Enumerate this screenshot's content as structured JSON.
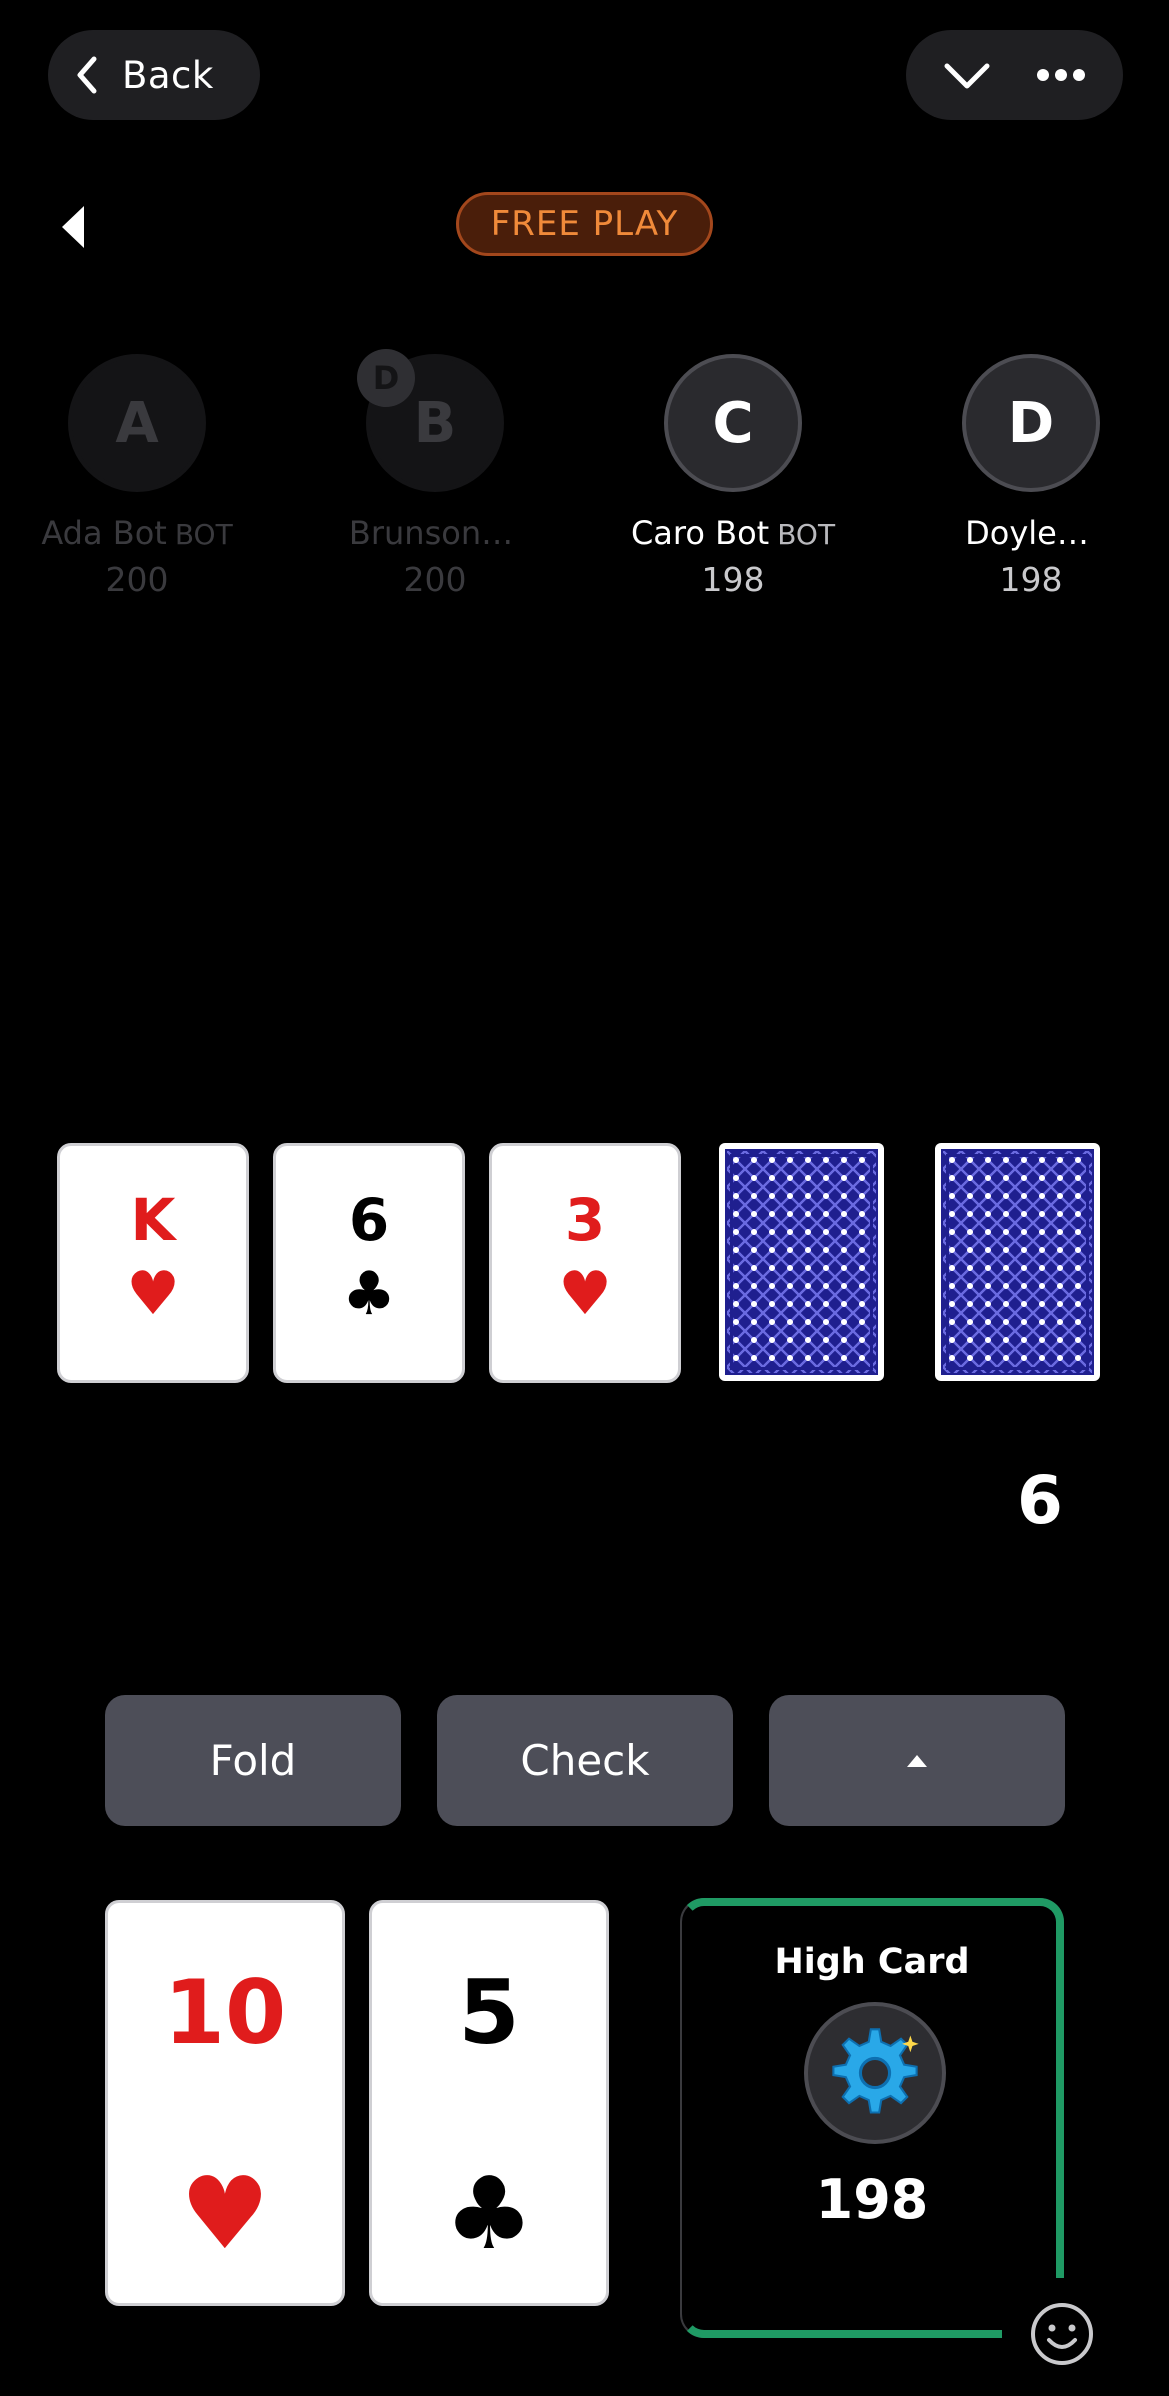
{
  "nav": {
    "back_label": "Back"
  },
  "badge": {
    "label": "FREE PLAY"
  },
  "players": [
    {
      "initial": "A",
      "name": "Ada Bot",
      "bot_tag": "BOT",
      "stack": "200",
      "faded": true,
      "dealer": false
    },
    {
      "initial": "B",
      "name": "Brunson…",
      "bot_tag": "",
      "stack": "200",
      "faded": true,
      "dealer": true
    },
    {
      "initial": "C",
      "name": "Caro Bot",
      "bot_tag": "BOT",
      "stack": "198",
      "faded": false,
      "dealer": false
    },
    {
      "initial": "D",
      "name": "Doyle…",
      "bot_tag": "",
      "stack": "198",
      "faded": false,
      "dealer": false
    }
  ],
  "dealer_label": "D",
  "board": [
    {
      "rank": "K",
      "suit": "♥",
      "color": "red",
      "face_up": true
    },
    {
      "rank": "6",
      "suit": "♣",
      "color": "black",
      "face_up": true
    },
    {
      "rank": "3",
      "suit": "♥",
      "color": "red",
      "face_up": true
    },
    {
      "face_up": false
    },
    {
      "face_up": false
    }
  ],
  "pot": "6",
  "actions": {
    "fold": "Fold",
    "check": "Check",
    "raise_icon": "caret-up-icon"
  },
  "hole_cards": [
    {
      "rank": "10",
      "suit": "♥",
      "color": "red"
    },
    {
      "rank": "5",
      "suit": "♣",
      "color": "black"
    }
  ],
  "hand": {
    "rank_name": "High Card",
    "stack": "198",
    "avatar_icon": "gear-icon"
  },
  "colors": {
    "accent_green": "#1f9a64",
    "badge_orange": "#f08a3a",
    "button_gray": "#4d4e58"
  }
}
